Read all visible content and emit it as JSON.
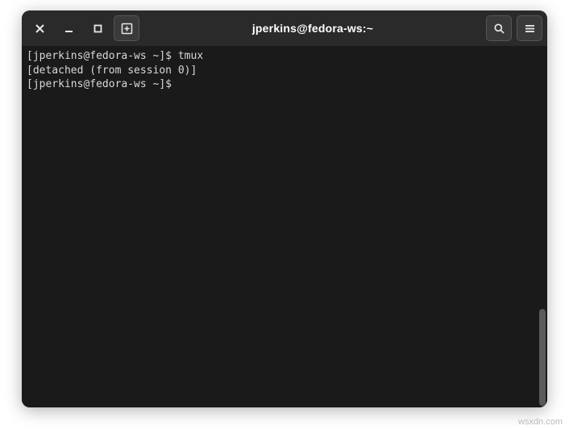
{
  "titlebar": {
    "title": "jperkins@fedora-ws:~"
  },
  "terminal": {
    "lines": [
      "[jperkins@fedora-ws ~]$ tmux",
      "[detached (from session 0)]",
      "[jperkins@fedora-ws ~]$ "
    ]
  },
  "watermark": "wsxdn.com"
}
